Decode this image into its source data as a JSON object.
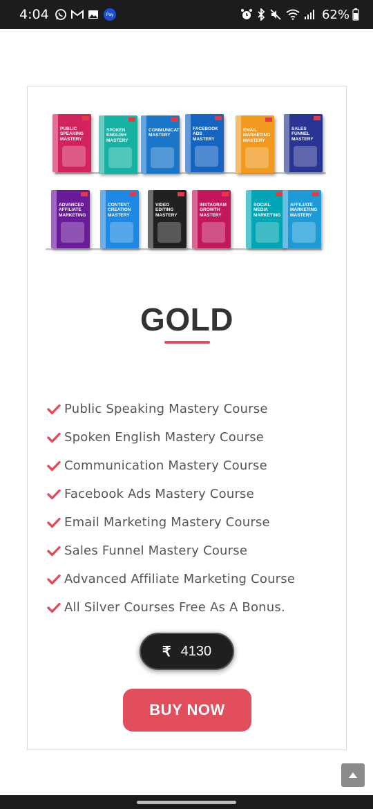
{
  "status_bar": {
    "time": "4:04",
    "battery": "62%",
    "left_icons": [
      "whatsapp-icon",
      "gmail-icon",
      "gallery-icon",
      "pay-icon"
    ],
    "right_icons": [
      "alarm-icon",
      "bluetooth-icon",
      "mute-icon",
      "wifi-icon",
      "signal-icon",
      "battery-icon"
    ]
  },
  "products": [
    {
      "name": "Public Speaking Mastery",
      "color": "#d1245f"
    },
    {
      "name": "Spoken English Mastery",
      "color": "#16b3a4"
    },
    {
      "name": "Communication Mastery",
      "color": "#1976c9"
    },
    {
      "name": "Facebook Ads Mastery",
      "color": "#1565c0"
    },
    {
      "name": "Email Marketing Mastery",
      "color": "#f29a1f"
    },
    {
      "name": "Sales Funnel Mastery",
      "color": "#283593"
    },
    {
      "name": "Advanced Affiliate Marketing",
      "color": "#6a1b9a"
    },
    {
      "name": "Content Creation Mastery",
      "color": "#1e88e5"
    },
    {
      "name": "Video Editing Mastery",
      "color": "#212121"
    },
    {
      "name": "Instagram Growth Mastery",
      "color": "#c2185b"
    },
    {
      "name": "Social Media Marketing",
      "color": "#00a6b5"
    },
    {
      "name": "Affiliate Marketing Mastery",
      "color": "#1e9bd7"
    }
  ],
  "plan": {
    "title": "GOLD",
    "accent_color": "#e14b5a",
    "features": [
      "Public Speaking Mastery Course",
      "Spoken English Mastery Course",
      "Communication Mastery Course",
      "Facebook Ads Mastery Course",
      "Email Marketing Mastery Course",
      "Sales Funnel Mastery Course",
      "Advanced Affiliate Marketing Course",
      "All Silver Courses Free As A Bonus."
    ],
    "currency_symbol": "₹",
    "price": "4130",
    "buy_label": "BUY NOW"
  },
  "scroll_top_icon": "chevron-up-icon"
}
